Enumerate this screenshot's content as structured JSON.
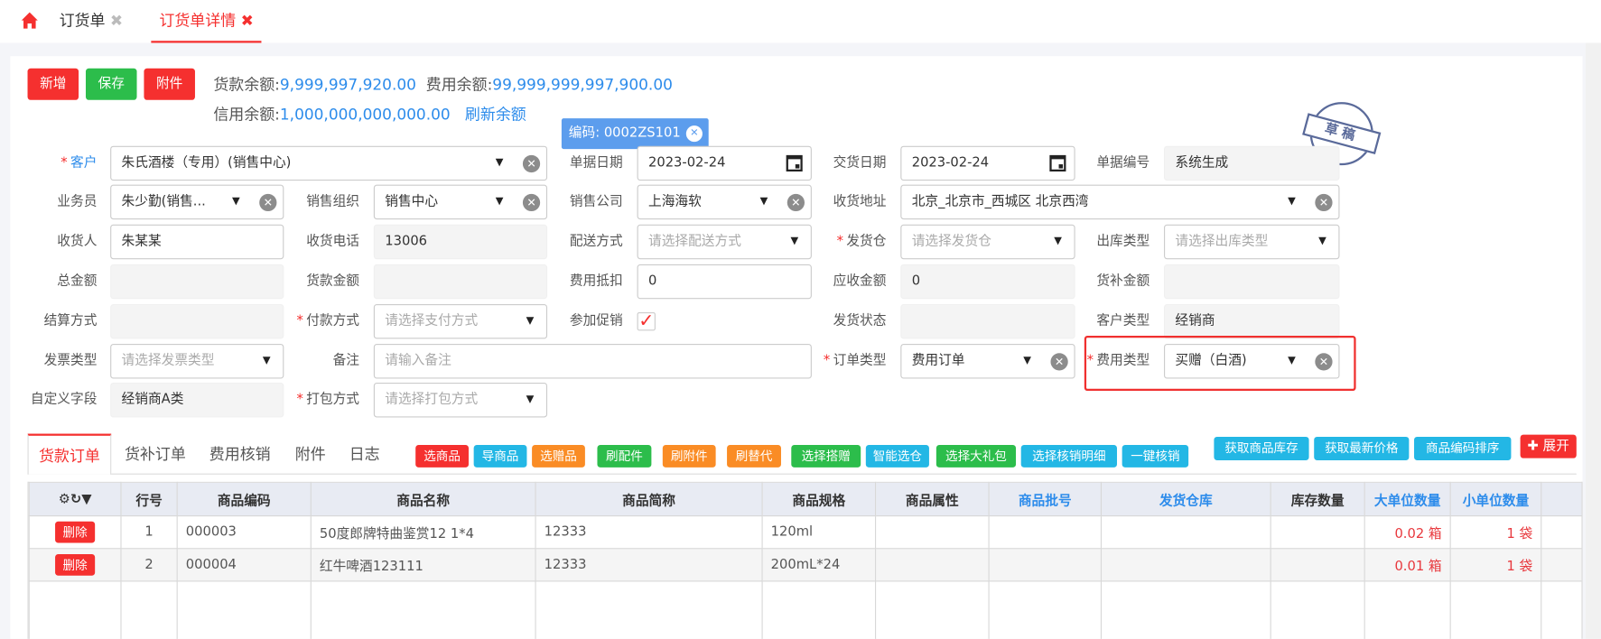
{
  "tabs": [
    {
      "label": "订货单"
    },
    {
      "label": "订货单详情"
    }
  ],
  "toolbar": {
    "add": "新增",
    "save": "保存",
    "attach": "附件"
  },
  "balance": {
    "goods_label": "货款余额:",
    "goods_value": "9,999,997,920.00",
    "fee_label": "费用余额:",
    "fee_value": "99,999,999,997,900.00",
    "credit_label": "信用余额:",
    "credit_value": "1,000,000,000,000.00",
    "refresh": "刷新余额"
  },
  "code_tooltip": "编码: 0002ZS101",
  "stamp": "草稿",
  "form": {
    "customer": {
      "label": "客户",
      "value": "朱氏酒楼（专用）(销售中心)"
    },
    "doc_date": {
      "label": "单据日期",
      "value": "2023-02-24"
    },
    "trade_date": {
      "label": "交货日期",
      "value": "2023-02-24"
    },
    "doc_no": {
      "label": "单据编号",
      "value": "系统生成"
    },
    "salesman": {
      "label": "业务员",
      "value": "朱少勤(销售..."
    },
    "sales_org": {
      "label": "销售组织",
      "value": "销售中心"
    },
    "sales_company": {
      "label": "销售公司",
      "value": "上海海软"
    },
    "address": {
      "label": "收货地址",
      "value": "北京_北京市_西城区 北京西湾"
    },
    "receiver": {
      "label": "收货人",
      "value": "朱某某"
    },
    "phone": {
      "label": "收货电话",
      "value": "13006"
    },
    "delivery": {
      "label": "配送方式",
      "placeholder": "请选择配送方式"
    },
    "warehouse": {
      "label": "发货仓",
      "placeholder": "请选择发货仓"
    },
    "outbound_type": {
      "label": "出库类型",
      "placeholder": "请选择出库类型"
    },
    "total": {
      "label": "总金额"
    },
    "goods_amount": {
      "label": "货款金额"
    },
    "fee_deduct": {
      "label": "费用抵扣",
      "value": "0"
    },
    "receivable": {
      "label": "应收金额",
      "value": "0"
    },
    "subsidy": {
      "label": "货补金额"
    },
    "settlement": {
      "label": "结算方式"
    },
    "payment": {
      "label": "付款方式",
      "placeholder": "请选择支付方式"
    },
    "promo": {
      "label": "参加促销",
      "checked": true
    },
    "ship_status": {
      "label": "发货状态"
    },
    "customer_type": {
      "label": "客户类型",
      "value": "经销商"
    },
    "invoice": {
      "label": "发票类型",
      "placeholder": "请选择发票类型"
    },
    "remark": {
      "label": "备注",
      "placeholder": "请输入备注"
    },
    "order_type": {
      "label": "订单类型",
      "value": "费用订单"
    },
    "fee_type": {
      "label": "费用类型",
      "value": "买赠（白酒)"
    },
    "custom": {
      "label": "自定义字段",
      "value": "经销商A类"
    },
    "packing": {
      "label": "打包方式",
      "placeholder": "请选择打包方式"
    }
  },
  "subtabs": [
    "货款订单",
    "货补订单",
    "费用核销",
    "附件",
    "日志"
  ],
  "actions": [
    "选商品",
    "导商品",
    "选赠品",
    "刷配件",
    "刷附件",
    "刷替代",
    "选择搭赠",
    "智能选仓",
    "选择大礼包",
    "选择核销明细",
    "一键核销"
  ],
  "right_actions": [
    "获取商品库存",
    "获取最新价格",
    "商品编码排序"
  ],
  "expand": "展开",
  "table": {
    "headers": [
      "行号",
      "商品编码",
      "商品名称",
      "商品简称",
      "商品规格",
      "商品属性",
      "商品批号",
      "发货仓库",
      "库存数量",
      "大单位数量",
      "小单位数量"
    ],
    "delete_label": "删除",
    "rows": [
      {
        "no": "1",
        "code": "000003",
        "name": "50度郎牌特曲鉴赏12 1*4",
        "short": "12333",
        "spec": "120ml",
        "big": "0.02 箱",
        "small": "1 袋"
      },
      {
        "no": "2",
        "code": "000004",
        "name": "红牛啤酒123111",
        "short": "12333",
        "spec": "200mL*24",
        "big": "0.01 箱",
        "small": "1 袋"
      }
    ]
  },
  "colors": {
    "primary_red": "#f5302f",
    "blue": "#2d8ceb",
    "green": "#2cbd4b",
    "cyan": "#23b7e5",
    "orange": "#fa8c25"
  }
}
